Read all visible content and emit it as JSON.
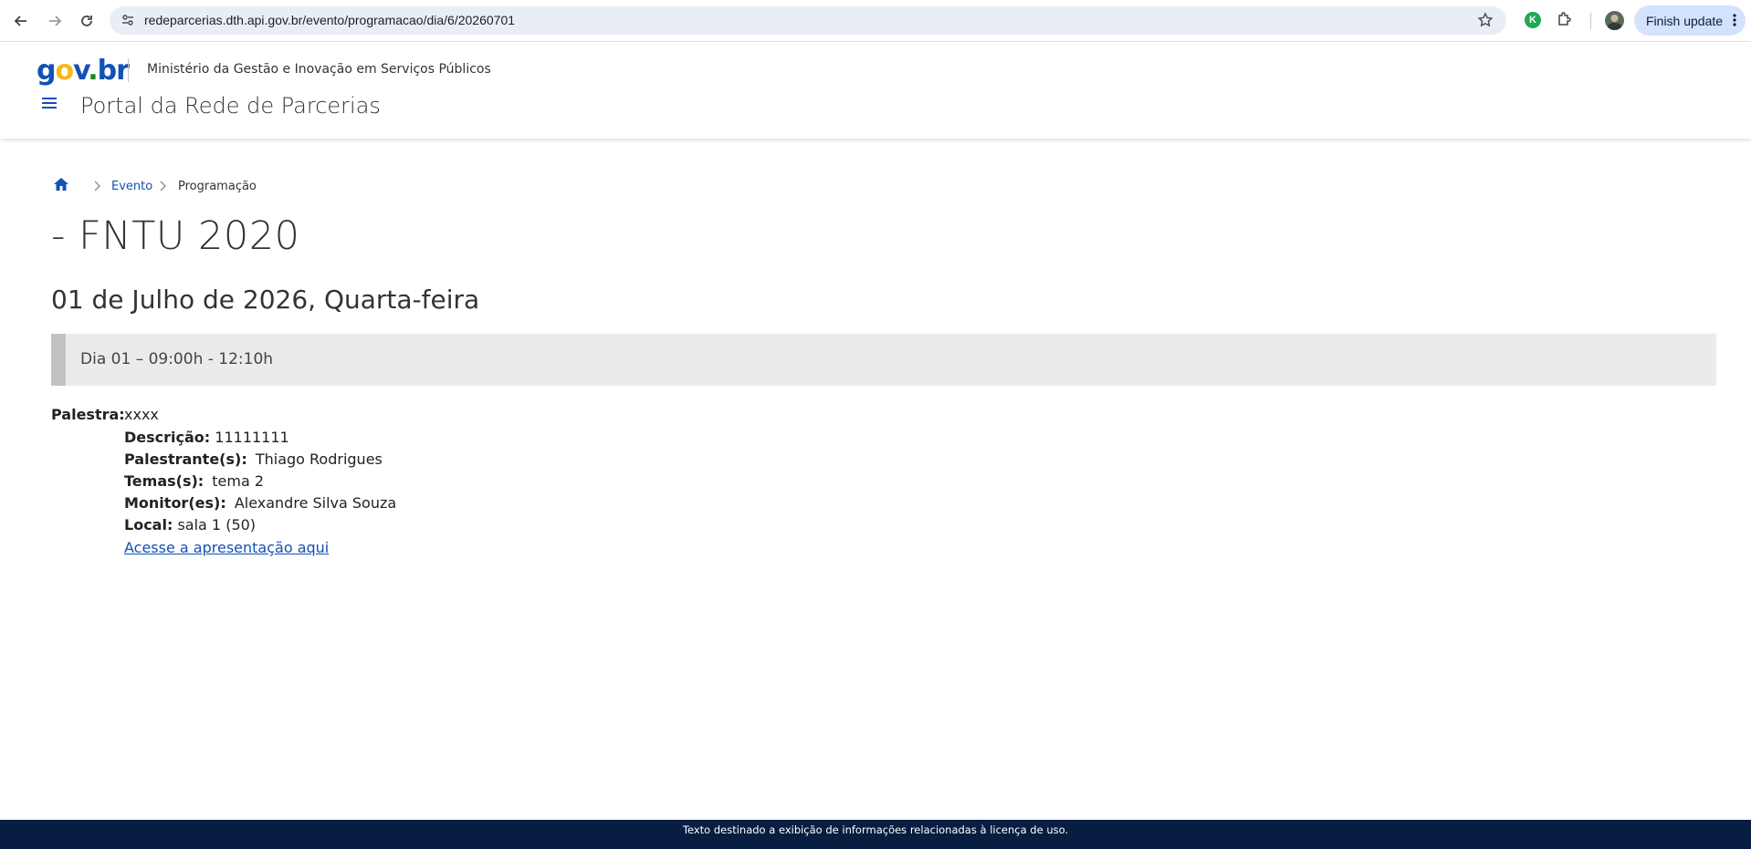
{
  "browser": {
    "url": "redeparcerias.dth.api.gov.br/evento/programacao/dia/6/20260701",
    "finish_update_label": "Finish update",
    "extension_badge": "K"
  },
  "header": {
    "logo": {
      "g": "g",
      "o": "o",
      "v": "v",
      "dot": ".",
      "br": "br"
    },
    "ministry": "Ministério da Gestão e Inovação em Serviços Públicos",
    "portal_title": "Portal da Rede de Parcerias"
  },
  "breadcrumb": {
    "items": [
      {
        "label": "Evento"
      },
      {
        "label": "Programação"
      }
    ]
  },
  "event": {
    "title": "- FNTU 2020",
    "date": "01 de Julho de 2026, Quarta-feira",
    "session": "Dia 01 – 09:00h - 12:10h"
  },
  "talk": {
    "palestra_label": "Palestra:",
    "palestra_value": "xxxx",
    "descricao_label": "Descrição:",
    "descricao_value": "11111111",
    "palestrantes_label": "Palestrante(s):",
    "palestrantes_value": "Thiago Rodrigues",
    "temas_label": "Temas(s):",
    "temas_value": "tema 2",
    "monitores_label": "Monitor(es):",
    "monitores_value": "Alexandre Silva Souza",
    "local_label": "Local:",
    "local_value": "sala 1 (50)",
    "link_label": "Acesse a apresentação aqui"
  },
  "footer": {
    "text": "Texto destinado a exibição de informações relacionadas à licença de uso."
  },
  "colors": {
    "brand_blue": "#1351b4",
    "footer_bg": "#071d41",
    "session_bg": "#ebebeb"
  }
}
